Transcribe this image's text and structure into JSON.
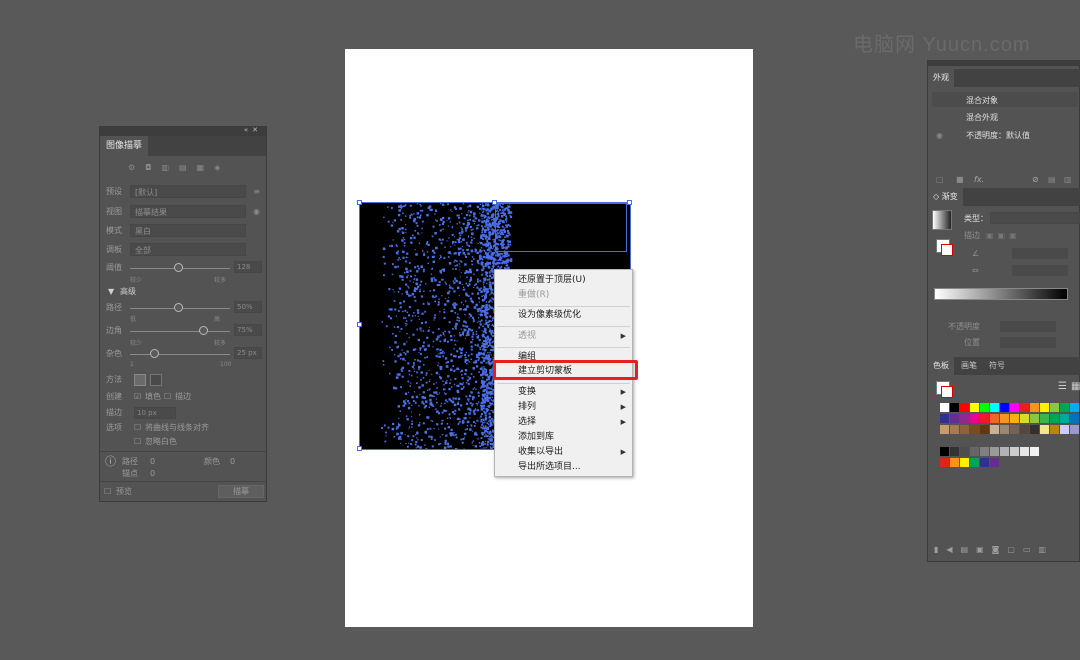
{
  "watermark": "电脑网 Yuucn.com",
  "trace_panel": {
    "tab": "图像描摹",
    "preset_label": "预设",
    "preset_value": "[默认]",
    "view_label": "视图",
    "view_value": "描摹结果",
    "mode_label": "模式",
    "mode_value": "黑白",
    "palette_label": "调板",
    "palette_value": "全部",
    "threshold_label": "阈值",
    "threshold_value": "128",
    "threshold_min": "较少",
    "threshold_max": "较多",
    "advanced_label": "高级",
    "paths_label": "路径",
    "paths_value": "50%",
    "paths_min": "低",
    "paths_max": "高",
    "corners_label": "边角",
    "corners_value": "75%",
    "corners_min": "较少",
    "corners_max": "较多",
    "noise_label": "杂色",
    "noise_value": "25 px",
    "noise_min": "1",
    "noise_max": "100",
    "method_label": "方法",
    "create_label": "创建",
    "fill_label": "填色",
    "stroke_label": "描边",
    "stroke_width_label": "描边",
    "stroke_width_value": "10 px",
    "options_label": "选项",
    "snap_label": "将曲线与线条对齐",
    "ignore_white_label": "忽略白色",
    "info_paths_label": "路径",
    "info_paths_value": "0",
    "info_colors_label": "颜色",
    "info_colors_value": "0",
    "info_anchors_label": "锚点",
    "info_anchors_value": "0",
    "preview_label": "预览",
    "trace_button": "描摹"
  },
  "context_menu": {
    "items": [
      {
        "label": "还原置于顶层(U)",
        "disabled": false,
        "submenu": false
      },
      {
        "label": "重做(R)",
        "disabled": true,
        "submenu": false
      },
      {
        "label": "设为像素级优化",
        "disabled": false,
        "submenu": false
      },
      {
        "label": "透视",
        "disabled": true,
        "submenu": true
      },
      {
        "label": "编组",
        "disabled": false,
        "submenu": false
      },
      {
        "label": "建立剪切蒙板",
        "disabled": false,
        "submenu": false,
        "highlighted": true
      },
      {
        "label": "变换",
        "disabled": false,
        "submenu": true
      },
      {
        "label": "排列",
        "disabled": false,
        "submenu": true
      },
      {
        "label": "选择",
        "disabled": false,
        "submenu": true
      },
      {
        "label": "添加到库",
        "disabled": false,
        "submenu": false
      },
      {
        "label": "收集以导出",
        "disabled": false,
        "submenu": true
      },
      {
        "label": "导出所选项目...",
        "disabled": false,
        "submenu": false
      }
    ],
    "highlight_color": "#e8201c"
  },
  "appearance_panel": {
    "tab": "外观",
    "row1": "混合对象",
    "row2": "混合外观",
    "row3": "不透明度：默认值",
    "fx": "fx."
  },
  "gradient_panel": {
    "tab": "渐变",
    "type_label": "类型：",
    "stroke_label": "描边",
    "opacity_label": "不透明度",
    "location_label": "位置"
  },
  "swatches_panel": {
    "tabs": [
      "色板",
      "画笔",
      "符号"
    ]
  },
  "colors": {
    "accent_selection": "#4a6bd8",
    "particles": "#4a6fe6"
  }
}
